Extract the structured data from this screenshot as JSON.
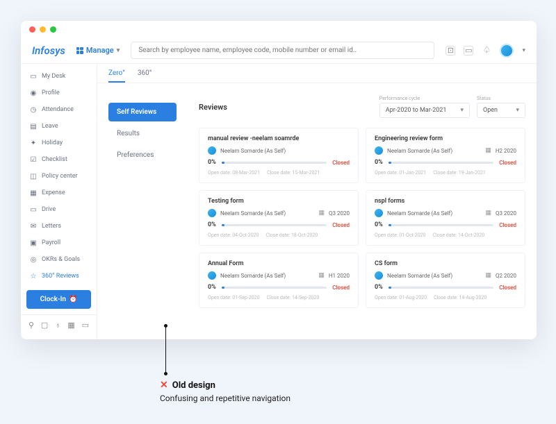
{
  "logo": "Infosys",
  "manage_label": "Manage",
  "search_placeholder": "Search by employee name, employee code, mobile number or email id..",
  "sidebar": {
    "items": [
      {
        "label": "My Desk"
      },
      {
        "label": "Profile"
      },
      {
        "label": "Attendance"
      },
      {
        "label": "Leave"
      },
      {
        "label": "Holiday"
      },
      {
        "label": "Checklist"
      },
      {
        "label": "Policy center"
      },
      {
        "label": "Expense"
      },
      {
        "label": "Drive"
      },
      {
        "label": "Letters"
      },
      {
        "label": "Payroll"
      },
      {
        "label": "OKRs & Goals"
      },
      {
        "label": "360° Reviews"
      }
    ],
    "clockin": "Clock-In"
  },
  "tabs": [
    {
      "label": "Zero°"
    },
    {
      "label": "360°"
    }
  ],
  "subnav": [
    {
      "label": "Self Reviews"
    },
    {
      "label": "Results"
    },
    {
      "label": "Preferences"
    }
  ],
  "reviews_title": "Reviews",
  "cycle_label": "Performance cycle",
  "cycle_value": "Apr-2020 to Mar-2021",
  "status_label": "Status",
  "status_value": "Open",
  "cards": [
    {
      "title": "manual review -neelam soamrde",
      "person": "Neelam Somarde (As Self)",
      "period": "",
      "pct": "0%",
      "status": "Closed",
      "open": "Open date: 08-Mar-2021",
      "close": "Close date: 15-Mar-2021"
    },
    {
      "title": "Engineering review form",
      "person": "Neelam Somarde (As Self)",
      "period": "H2 2020",
      "pct": "0%",
      "status": "Closed",
      "open": "Open date: 01-Jan-2021",
      "close": "Close date: 19-Jan-2021"
    },
    {
      "title": "Testing form",
      "person": "Neelam Somarde (As Self)",
      "period": "Q3 2020",
      "pct": "0%",
      "status": "Closed",
      "open": "Open date: 04-Oct-2020",
      "close": "Close date: 18-Oct-2020"
    },
    {
      "title": "nspl forms",
      "person": "Neelam Somarde (As Self)",
      "period": "Q3 2020",
      "pct": "0%",
      "status": "Closed",
      "open": "Open date: 01-Oct-2020",
      "close": "Close date: 14-Oct-2020"
    },
    {
      "title": "Annual Form",
      "person": "Neelam Somarde (As Self)",
      "period": "H1 2020",
      "pct": "0%",
      "status": "Closed",
      "open": "Open date: 01-Sep-2020",
      "close": "Close date: 14-Sep-2020"
    },
    {
      "title": "CS form",
      "person": "Neelam Somarde (As Self)",
      "period": "Q2 2020",
      "pct": "0%",
      "status": "Closed",
      "open": "Open date: 01-Aug-2020",
      "close": "Close date: 14-Aug-2020"
    }
  ],
  "annotation": {
    "head": "Old design",
    "sub": "Confusing and repetitive navigation"
  }
}
